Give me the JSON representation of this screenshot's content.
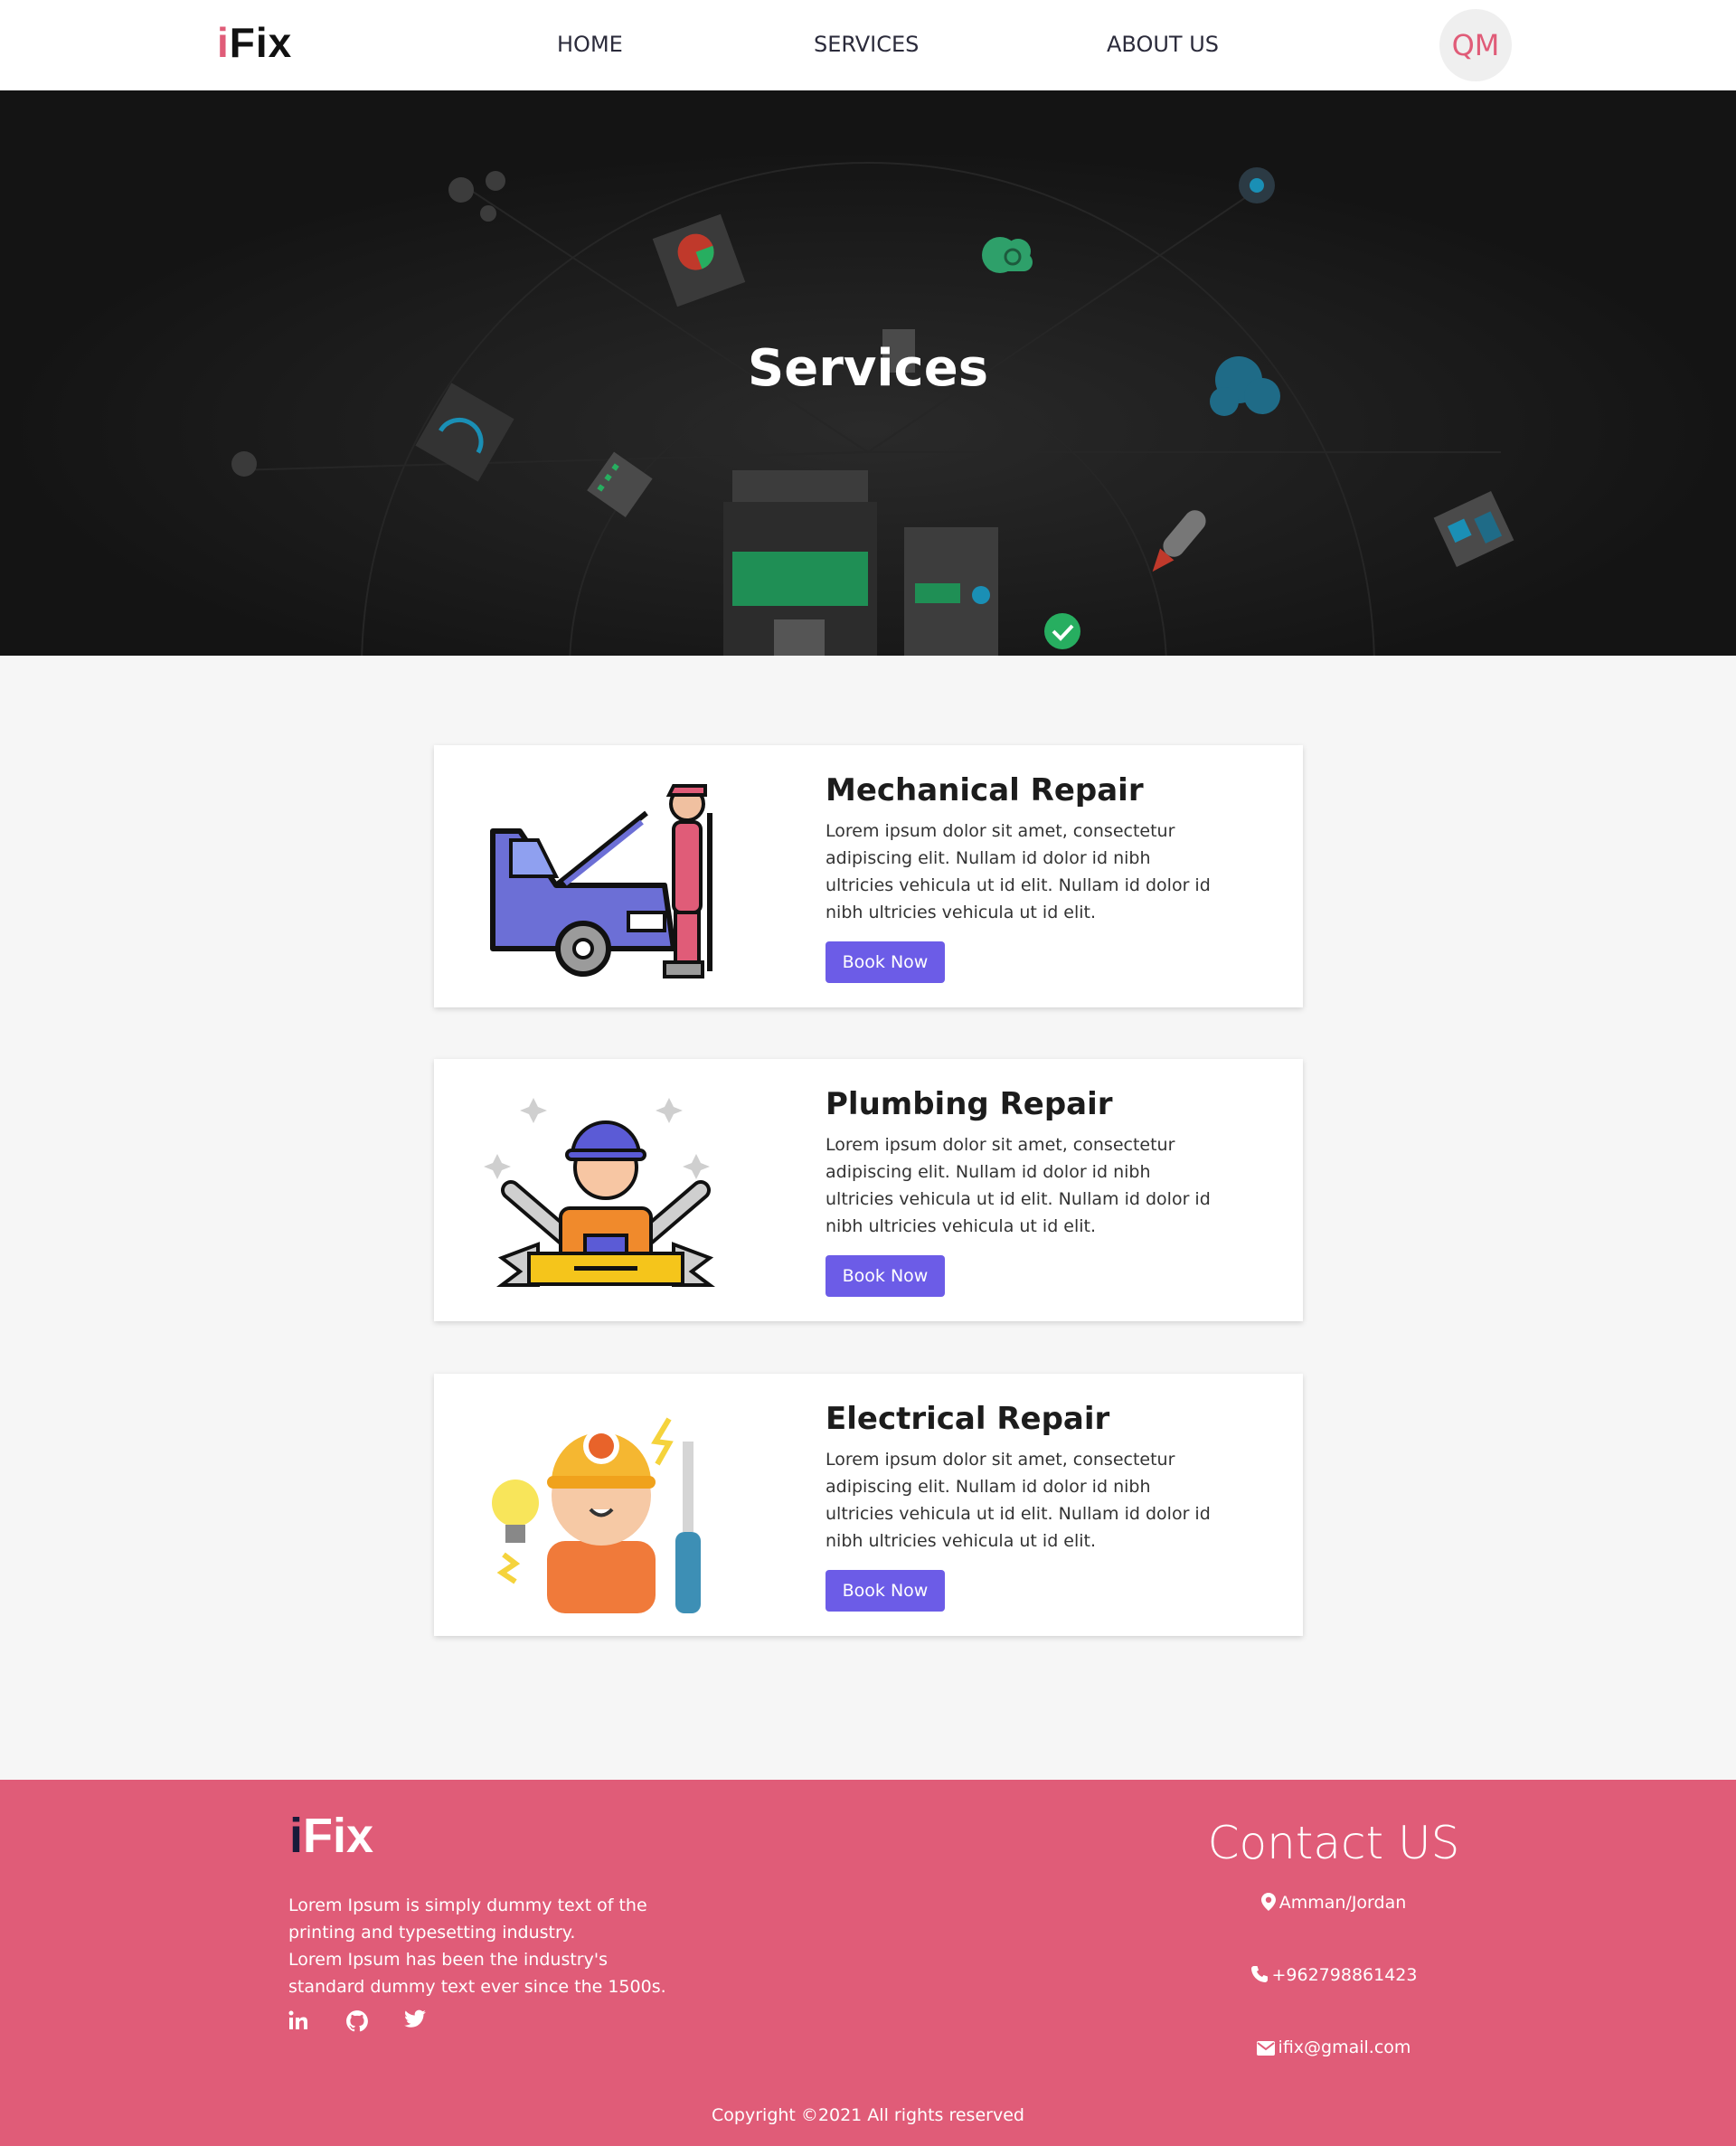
{
  "brand": {
    "logo_i": "i",
    "logo_rest": "Fix"
  },
  "nav": {
    "home": "HOME",
    "services": "SERVICES",
    "about": "ABOUT US",
    "avatar_initials": "QM"
  },
  "hero": {
    "title": "Services"
  },
  "services": [
    {
      "title": "Mechanical Repair",
      "description": "Lorem ipsum dolor sit amet, consectetur adipiscing elit. Nullam id dolor id nibh ultricies vehicula ut id elit. Nullam id dolor id nibh ultricies vehicula ut id elit.",
      "button": "Book Now",
      "icon": "car-mechanic-illustration"
    },
    {
      "title": "Plumbing Repair",
      "description": "Lorem ipsum dolor sit amet, consectetur adipiscing elit. Nullam id dolor id nibh ultricies vehicula ut id elit. Nullam id dolor id nibh ultricies vehicula ut id elit.",
      "button": "Book Now",
      "icon": "plumber-illustration"
    },
    {
      "title": "Electrical Repair",
      "description": "Lorem ipsum dolor sit amet, consectetur adipiscing elit. Nullam id dolor id nibh ultricies vehicula ut id elit. Nullam id dolor id nibh ultricies vehicula ut id elit.",
      "button": "Book Now",
      "icon": "electrician-illustration"
    }
  ],
  "footer": {
    "logo_i": "i",
    "logo_rest": "Fix",
    "about_line1": "Lorem Ipsum is simply dummy text of the printing and typesetting industry.",
    "about_line2": "Lorem Ipsum has been the industry's standard dummy text ever since the 1500s.",
    "social": [
      "linkedin-icon",
      "github-icon",
      "twitter-icon"
    ],
    "contact_title": "Contact US",
    "address": "Amman/Jordan",
    "phone": "+962798861423",
    "email": "ifix@gmail.com",
    "copyright": "Copyright ©2021 All rights reserved"
  },
  "colors": {
    "brand_pink": "#e05c78",
    "button_purple": "#6c5ce7",
    "hero_bg": "#141414",
    "page_bg": "#f6f6f6"
  }
}
